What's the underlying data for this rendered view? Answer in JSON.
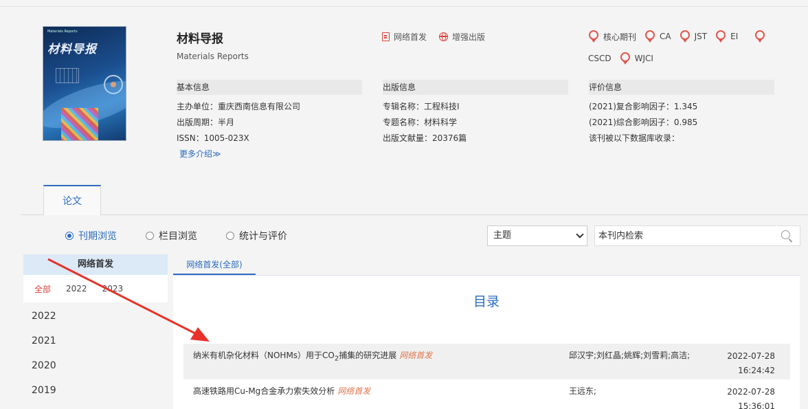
{
  "journal": {
    "title": "材料导报",
    "subtitle": "Materials Reports",
    "cover_title": "材料导报",
    "cover_small": "Materials Reports"
  },
  "links": [
    {
      "label": "网络首发",
      "icon": "document-icon"
    },
    {
      "label": "增强出版",
      "icon": "globe-icon"
    }
  ],
  "badges": [
    "核心期刊",
    "CA",
    "JST",
    "EI",
    "CSCD",
    "WJCI"
  ],
  "basic_info": {
    "heading": "基本信息",
    "lines": [
      "主办单位：重庆西南信息有限公司",
      "出版周期：半月",
      "ISSN：1005-023X"
    ],
    "more": "更多介绍≫"
  },
  "publish_info": {
    "heading": "出版信息",
    "lines": [
      "专辑名称：工程科技I",
      "专题名称：材料科学",
      "出版文献量：20376篇"
    ]
  },
  "eval_info": {
    "heading": "评价信息",
    "lines": [
      "(2021)复合影响因子：1.345",
      "(2021)综合影响因子：0.985",
      "该刊被以下数据库收录："
    ]
  },
  "tab": {
    "label": "论文"
  },
  "radios": [
    {
      "label": "刊期浏览",
      "active": true
    },
    {
      "label": "栏目浏览",
      "active": false
    },
    {
      "label": "统计与评价",
      "active": false
    }
  ],
  "search": {
    "select_value": "主题",
    "placeholder": "本刊内检索"
  },
  "left_panel": {
    "heading": "网络首发",
    "years_inline": [
      "全部",
      "2022",
      "2023"
    ],
    "years_list": [
      "2022",
      "2021",
      "2020",
      "2019"
    ]
  },
  "right_tab": {
    "label": "网络首发(全部)"
  },
  "toc": {
    "title": "目录"
  },
  "articles": [
    {
      "title_pre": "纳米有机杂化材料（NOHMs）用于CO",
      "title_sub": "2",
      "title_post": "捕集的研究进展",
      "tag": "网络首发",
      "authors": "邱汉宇;刘红晶;姚辉;刘雪莉;高洁;",
      "date": "2022-07-28",
      "time": "16:24:42"
    },
    {
      "title_pre": "高速铁路用Cu-Mg合金承力索失效分析",
      "title_sub": "",
      "title_post": "",
      "tag": "网络首发",
      "authors": "王远东;",
      "date": "2022-07-28",
      "time": "15:36:01"
    }
  ],
  "colors": {
    "accent": "#2a6bbd",
    "badge": "#e0554c",
    "tag": "#e0754c"
  }
}
